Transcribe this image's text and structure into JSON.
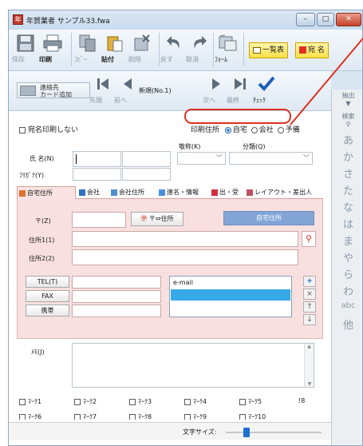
{
  "window": {
    "title": "年賀業者 サンプル33.fwa",
    "minimize_label": "–",
    "maximize_label": "□",
    "close_label": "✕"
  },
  "toolbar1": {
    "save_label": "保存",
    "print_label": "印刷",
    "copy_label": "ｺﾋﾟｰ",
    "paste_label": "貼付",
    "delete_label": "削除",
    "undo_label": "戻す",
    "redo_label": "取消",
    "form_label": "ﾌｫｰﾑ",
    "list_label": "一覧表",
    "addressee_label": "宛 名"
  },
  "toolbar2": {
    "add_card_line1": "連絡先",
    "add_card_line2": "カード追加",
    "first_label": "先頭",
    "prev_label": "前へ",
    "current_record": "新規(No.1)",
    "next_label": "次へ",
    "last_label": "最終",
    "check_label": "ﾁｪｯｸ"
  },
  "form": {
    "no_print_label": "宛名印刷しない",
    "print_address_label": "印刷住所",
    "radio_home": "自宅",
    "radio_company": "会社",
    "radio_spare": "予備",
    "honorific_label": "敬称(K)",
    "category_label": "分類(Q)",
    "name_label": "氏 名(N)",
    "furigana_label": "ﾌﾘｶﾞﾅ(Y)",
    "name_value": "",
    "furigana_value": ""
  },
  "tabs": [
    {
      "label": "自宅住所",
      "active": true
    },
    {
      "label": "会社",
      "active": false
    },
    {
      "label": "会社住所",
      "active": false
    },
    {
      "label": "連名・情報",
      "active": false
    },
    {
      "label": "出・受",
      "active": false
    },
    {
      "label": "レイアウト・差出人",
      "active": false
    }
  ],
  "address": {
    "zip_label": "〒(Z)",
    "zip_convert_label": "〒⇔住所",
    "home_address_header": "自宅住所",
    "address1_label": "住所1(1)",
    "address2_label": "住所2(2)",
    "tel_label": "TEL(T)",
    "fax_label": "FAX",
    "mobile_label": "携帯",
    "email_header": "e-mail",
    "zip_value": "",
    "address1_value": "",
    "address2_value": ""
  },
  "memo": {
    "label": "ﾒﾓ(J)"
  },
  "marks": [
    "ﾏｰｸ1",
    "ﾏｰｸ2",
    "ﾏｰｸ3",
    "ﾏｰｸ4",
    "ﾏｰｸ5",
    "ﾏｰｸ6",
    "ﾏｰｸ7",
    "ﾏｰｸ8",
    "ﾏｰｸ9",
    "ﾏｰｸ10"
  ],
  "marks_extra": "!8",
  "bottom": {
    "font_size_label": "文字サイズ:",
    "font_size_level": 0.2
  },
  "right_panel": {
    "extract_label": "抽出",
    "search_label": "検索",
    "kana": [
      "あ",
      "か",
      "さ",
      "た",
      "な",
      "は",
      "ま",
      "や",
      "ら",
      "わ",
      "abc",
      "他"
    ]
  },
  "colors": {
    "accent_red": "#e03020",
    "tab_pink": "#f9e0e0",
    "header_blue": "#82a5d6",
    "selection_blue": "#36a9e8"
  }
}
